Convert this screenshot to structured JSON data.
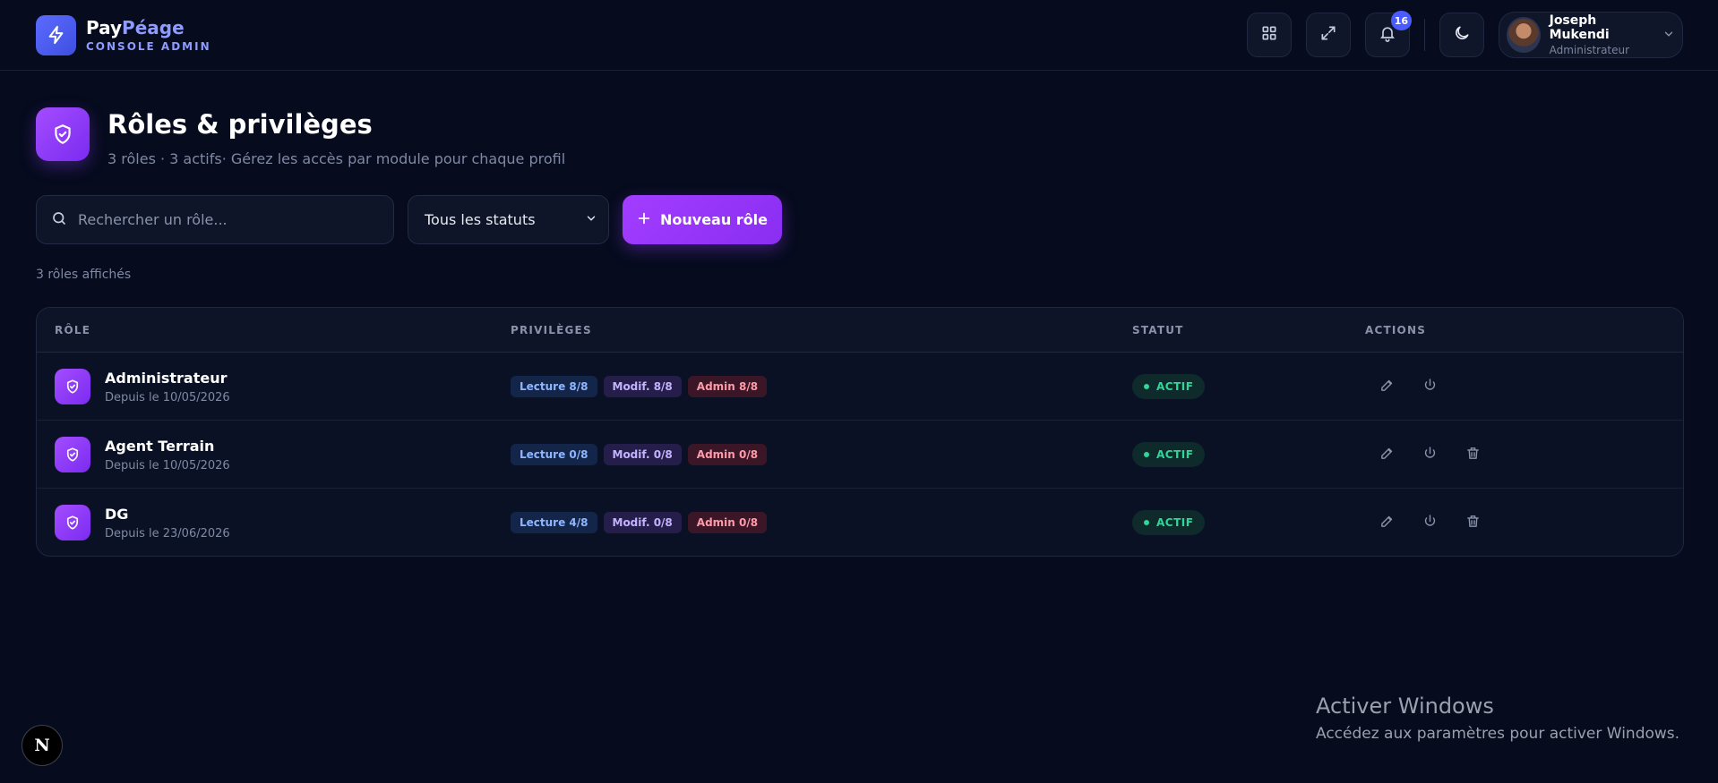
{
  "brand": {
    "name_part1": "Pay",
    "name_part2": "Péage",
    "subtitle": "CONSOLE ADMIN",
    "accent": "#8e9bff"
  },
  "header": {
    "notifications_count": "16",
    "user": {
      "name": "Joseph Mukendi",
      "role": "Administrateur"
    },
    "icons": [
      "grid-icon",
      "expand-icon",
      "bell-icon",
      "moon-icon",
      "chevron-down-icon"
    ]
  },
  "page": {
    "title": "Rôles & privilèges",
    "subtitle": "3 rôles · 3 actifs· Gérez les accès par module pour chaque profil"
  },
  "toolbar": {
    "search_placeholder": "Rechercher un rôle...",
    "status_filter": "Tous les statuts",
    "new_button": "Nouveau rôle"
  },
  "results_text": "3 rôles affichés",
  "table": {
    "headers": {
      "role": "RÔLE",
      "privileges": "PRIVILÈGES",
      "status": "STATUT",
      "actions": "ACTIONS"
    },
    "rows": [
      {
        "name": "Administrateur",
        "since": "Depuis le 10/05/2026",
        "read": "Lecture 8/8",
        "modify": "Modif. 8/8",
        "admin": "Admin 8/8",
        "status": "ACTIF",
        "deletable": false
      },
      {
        "name": "Agent Terrain",
        "since": "Depuis le 10/05/2026",
        "read": "Lecture 0/8",
        "modify": "Modif. 0/8",
        "admin": "Admin 0/8",
        "status": "ACTIF",
        "deletable": true
      },
      {
        "name": "DG",
        "since": "Depuis le 23/06/2026",
        "read": "Lecture 4/8",
        "modify": "Modif. 0/8",
        "admin": "Admin 0/8",
        "status": "ACTIF",
        "deletable": true
      }
    ]
  },
  "watermark": {
    "title": "Activer Windows",
    "subtitle": "Accédez aux paramètres pour activer Windows."
  },
  "dev_badge": "N",
  "colors": {
    "primary": "#9a36ff",
    "active": "#2fd69a",
    "background": "#060b1d"
  }
}
